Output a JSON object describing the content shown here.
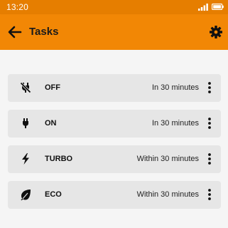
{
  "status_bar": {
    "time": "13:20",
    "icons": [
      "signal-icon",
      "battery-icon"
    ]
  },
  "app_bar": {
    "back_icon": "arrow-left-icon",
    "title": "Tasks",
    "settings_icon": "gear-icon"
  },
  "colors": {
    "status_bar": "#e67e00",
    "app_bar": "#f28705",
    "card_background": "#e6e6e6",
    "page_background": "#f5f5f5"
  },
  "tasks": [
    {
      "icon": "plug-off-icon",
      "name": "OFF",
      "time": "In 30 minutes",
      "menu_icon": "more-vertical-icon"
    },
    {
      "icon": "plug-icon",
      "name": "ON",
      "time": "In 30 minutes",
      "menu_icon": "more-vertical-icon"
    },
    {
      "icon": "lightning-icon",
      "name": "TURBO",
      "time": "Within 30 minutes",
      "menu_icon": "more-vertical-icon"
    },
    {
      "icon": "leaf-icon",
      "name": "ECO",
      "time": "Within 30 minutes",
      "menu_icon": "more-vertical-icon"
    }
  ]
}
